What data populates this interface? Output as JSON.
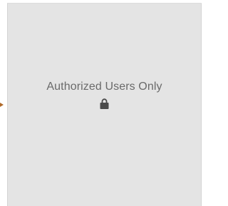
{
  "panel": {
    "message": "Authorized Users Only",
    "lock_icon": "lock-icon",
    "background_color": "#e4e4e4",
    "text_color": "#6a6a6a",
    "arrow_color": "#b06a2a"
  }
}
